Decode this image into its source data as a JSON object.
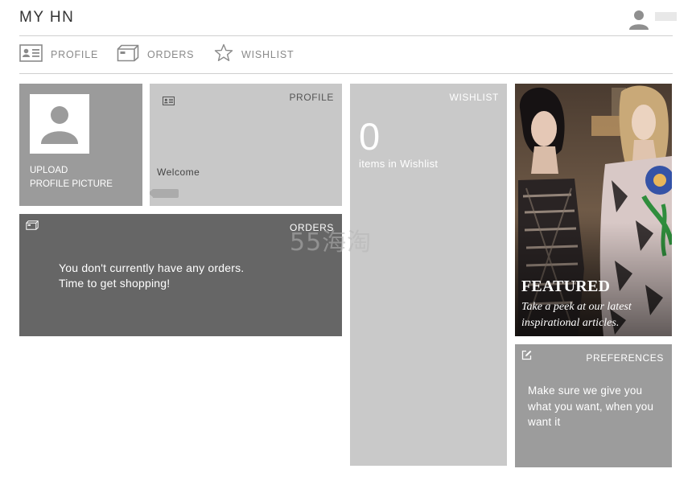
{
  "header": {
    "title": "MY HN",
    "user_icon": "user-icon"
  },
  "nav": {
    "items": [
      {
        "label": "PROFILE",
        "icon": "id-card-icon"
      },
      {
        "label": "ORDERS",
        "icon": "box-icon"
      },
      {
        "label": "WISHLIST",
        "icon": "star-icon"
      }
    ]
  },
  "tiles": {
    "upload": {
      "line1": "UPLOAD",
      "line2": "PROFILE PICTURE",
      "icon": "avatar-placeholder-icon"
    },
    "profile": {
      "label": "PROFILE",
      "welcome": "Welcome",
      "icon": "id-card-icon"
    },
    "orders": {
      "label": "ORDERS",
      "line1": "You don't currently have any orders.",
      "line2": "Time to get shopping!",
      "icon": "box-icon"
    },
    "wishlist": {
      "label": "WISHLIST",
      "count": "0",
      "count_label": "items in Wishlist"
    },
    "featured": {
      "title": "FEATURED",
      "text": "Take a peek at our latest inspirational articles."
    },
    "preferences": {
      "label": "PREFERENCES",
      "text": "Make sure we give you what you want, when you want it",
      "icon": "edit-icon"
    }
  },
  "watermark": "55海淘",
  "colors": {
    "tile_dark": "#666666",
    "tile_mid": "#9b9b9b",
    "tile_light": "#c8c8c8"
  }
}
